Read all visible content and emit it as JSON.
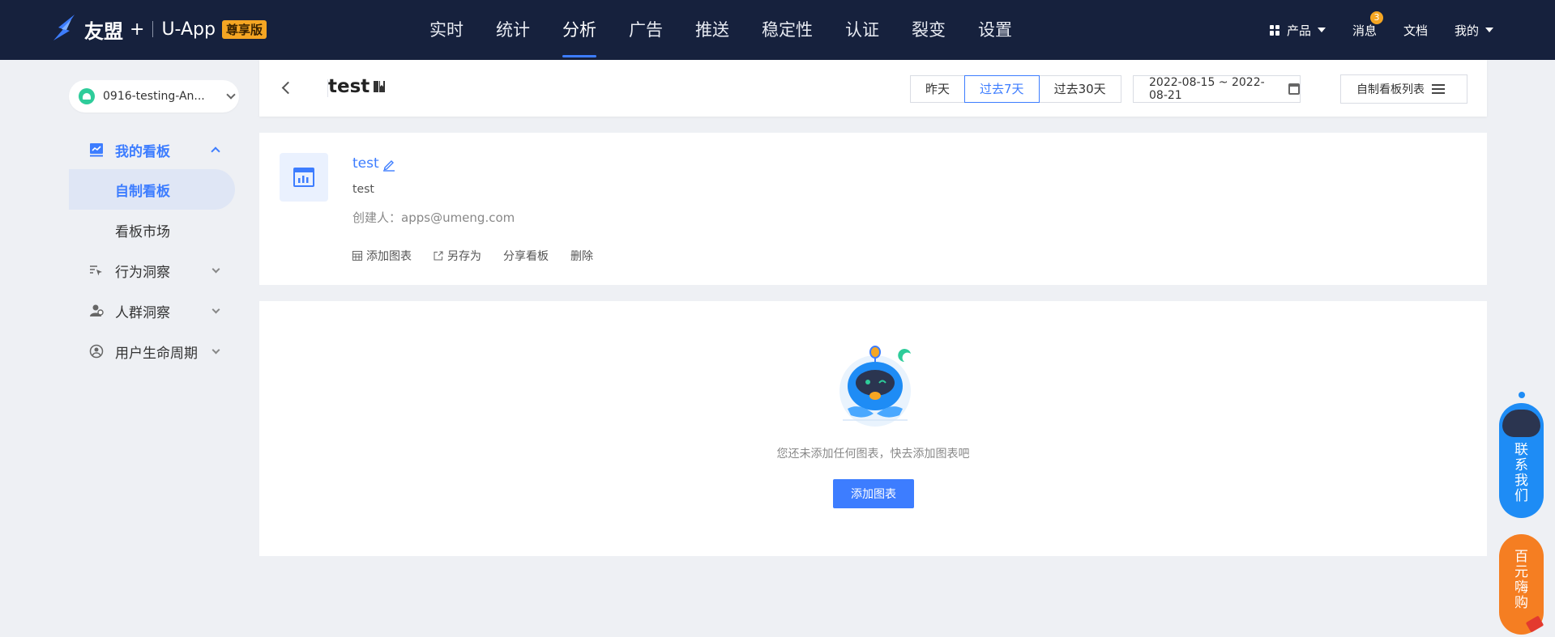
{
  "brand": {
    "name": "友盟",
    "plus": "+",
    "product": "U-App",
    "tier": "尊享版"
  },
  "nav": [
    "实时",
    "统计",
    "分析",
    "广告",
    "推送",
    "稳定性",
    "认证",
    "裂变",
    "设置"
  ],
  "nav_active": "分析",
  "top_right": {
    "products": "产品",
    "messages": "消息",
    "message_count": "3",
    "docs": "文档",
    "mine": "我的"
  },
  "sidebar": {
    "app_name": "0916-testing-An...",
    "groups": [
      {
        "label": "我的看板",
        "expanded": true,
        "children": [
          "自制看板",
          "看板市场"
        ],
        "active_child": "自制看板"
      },
      {
        "label": "行为洞察"
      },
      {
        "label": "人群洞察"
      },
      {
        "label": "用户生命周期"
      }
    ]
  },
  "header": {
    "title": "test",
    "ranges": [
      "昨天",
      "过去7天",
      "过去30天"
    ],
    "active_range": "过去7天",
    "date_range": "2022-08-15 ~ 2022-08-21",
    "board_list": "自制看板列表"
  },
  "board": {
    "name": "test",
    "description": "test",
    "creator_label": "创建人：",
    "creator": "apps@umeng.com",
    "actions": [
      "添加图表",
      "另存为",
      "分享看板",
      "删除"
    ]
  },
  "empty": {
    "message": "您还未添加任何图表，快去添加图表吧",
    "button": "添加图表"
  },
  "floating": {
    "contact": [
      "联",
      "系",
      "我",
      "们"
    ],
    "promo": [
      "百",
      "元",
      "嗨",
      "购"
    ]
  },
  "colors": {
    "nav_bg": "#16213d",
    "accent": "#3d7dff",
    "tier_badge": "#f5a623",
    "contact_bg": "#1e8cf5",
    "promo_bg": "#f57e22"
  }
}
